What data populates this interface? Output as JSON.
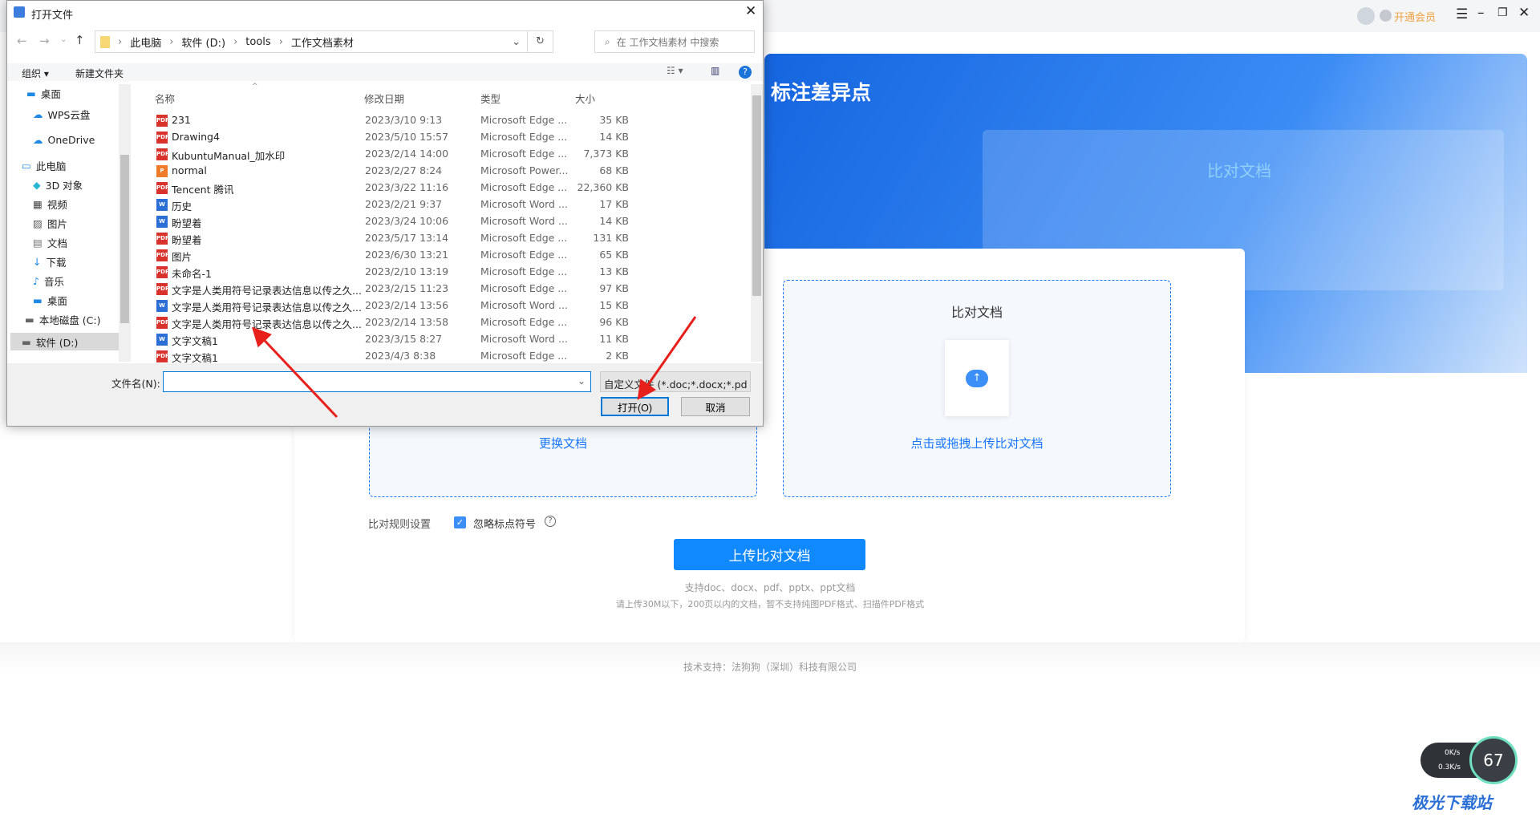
{
  "app": {
    "vip_label": "开通会员",
    "banner_title": "标注差异点",
    "banner_card_title": "比对文档",
    "left_box_link": "更换文档",
    "right_box_title": "比对文档",
    "right_box_link": "点击或拖拽上传比对文档",
    "rule_label": "比对规则设置",
    "ignore_punct": "忽略标点符号",
    "ignore_checked": true,
    "upload_button": "上传比对文档",
    "hint1": "支持doc、docx、pdf、pptx、ppt文档",
    "hint2": "请上传30M以下，200页以内的文档，暂不支持纯图PDF格式、扫描件PDF格式",
    "footer": "技术支持：法狗狗（深圳）科技有限公司",
    "speed": {
      "up": "0K/s",
      "down": "0.3K/s",
      "percent": "67"
    },
    "accent": "#1677ff"
  },
  "dialog": {
    "title": "打开文件",
    "breadcrumb": [
      "此电脑",
      "软件 (D:)",
      "tools",
      "工作文档素材"
    ],
    "search_placeholder": "在 工作文档素材 中搜索",
    "toolbar": {
      "organize": "组织 ▾",
      "new_folder": "新建文件夹"
    },
    "nav": [
      {
        "label": "桌面",
        "icon": "desktop"
      },
      {
        "label": "WPS云盘",
        "icon": "cloud"
      },
      {
        "label": "OneDrive",
        "icon": "cloud"
      },
      {
        "label": "此电脑",
        "icon": "computer"
      },
      {
        "label": "3D 对象",
        "icon": "cube"
      },
      {
        "label": "视频",
        "icon": "video"
      },
      {
        "label": "图片",
        "icon": "picture"
      },
      {
        "label": "文档",
        "icon": "document"
      },
      {
        "label": "下载",
        "icon": "download"
      },
      {
        "label": "音乐",
        "icon": "music"
      },
      {
        "label": "桌面",
        "icon": "desktop"
      },
      {
        "label": "本地磁盘 (C:)",
        "icon": "drive"
      },
      {
        "label": "软件 (D:)",
        "icon": "drive",
        "selected": true
      }
    ],
    "columns": [
      "名称",
      "修改日期",
      "类型",
      "大小"
    ],
    "files": [
      {
        "name": "231",
        "date": "2023/3/10 9:13",
        "type": "Microsoft Edge ...",
        "size": "35 KB",
        "icon": "pdf"
      },
      {
        "name": "Drawing4",
        "date": "2023/5/10 15:57",
        "type": "Microsoft Edge ...",
        "size": "14 KB",
        "icon": "pdf"
      },
      {
        "name": "KubuntuManual_加水印",
        "date": "2023/2/14 14:00",
        "type": "Microsoft Edge ...",
        "size": "7,373 KB",
        "icon": "pdf"
      },
      {
        "name": "normal",
        "date": "2023/2/27 8:24",
        "type": "Microsoft Power...",
        "size": "68 KB",
        "icon": "ppt"
      },
      {
        "name": "Tencent 腾讯",
        "date": "2023/3/22 11:16",
        "type": "Microsoft Edge ...",
        "size": "22,360 KB",
        "icon": "pdf"
      },
      {
        "name": "历史",
        "date": "2023/2/21 9:37",
        "type": "Microsoft Word ...",
        "size": "17 KB",
        "icon": "word"
      },
      {
        "name": "盼望着",
        "date": "2023/3/24 10:06",
        "type": "Microsoft Word ...",
        "size": "14 KB",
        "icon": "word"
      },
      {
        "name": "盼望着",
        "date": "2023/5/17 13:14",
        "type": "Microsoft Edge ...",
        "size": "131 KB",
        "icon": "pdf"
      },
      {
        "name": "图片",
        "date": "2023/6/30 13:21",
        "type": "Microsoft Edge ...",
        "size": "65 KB",
        "icon": "pdf"
      },
      {
        "name": "未命名-1",
        "date": "2023/2/10 13:19",
        "type": "Microsoft Edge ...",
        "size": "13 KB",
        "icon": "pdf"
      },
      {
        "name": "文字是人类用符号记录表达信息以传之久...",
        "date": "2023/2/15 11:23",
        "type": "Microsoft Edge ...",
        "size": "97 KB",
        "icon": "pdf"
      },
      {
        "name": "文字是人类用符号记录表达信息以传之久...",
        "date": "2023/2/14 13:56",
        "type": "Microsoft Word ...",
        "size": "15 KB",
        "icon": "word"
      },
      {
        "name": "文字是人类用符号记录表达信息以传之久...",
        "date": "2023/2/14 13:58",
        "type": "Microsoft Edge ...",
        "size": "96 KB",
        "icon": "pdf"
      },
      {
        "name": "文字文稿1",
        "date": "2023/3/15 8:27",
        "type": "Microsoft Word ...",
        "size": "11 KB",
        "icon": "word"
      },
      {
        "name": "文字文稿1",
        "date": "2023/4/3 8:38",
        "type": "Microsoft Edge ...",
        "size": "2 KB",
        "icon": "pdf"
      }
    ],
    "filename_label": "文件名(N):",
    "filename_value": "",
    "filetype": "自定义文件 (*.doc;*.docx;*.pd",
    "open_button": "打开(O)",
    "cancel_button": "取消"
  }
}
